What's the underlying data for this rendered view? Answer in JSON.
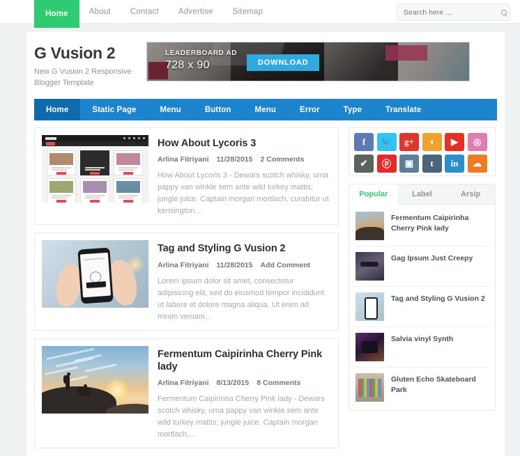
{
  "topbar": {
    "nav": [
      {
        "label": "Home",
        "active": true
      },
      {
        "label": "About",
        "active": false
      },
      {
        "label": "Contact",
        "active": false
      },
      {
        "label": "Advertise",
        "active": false
      },
      {
        "label": "Sitemap",
        "active": false
      }
    ],
    "search": {
      "placeholder": "Search here ...",
      "value": "",
      "icon": "search-icon"
    }
  },
  "header": {
    "brand_title": "G Vusion 2",
    "brand_description": "New G Vusion 2 Responsive Blogger Template",
    "ad": {
      "label": "LEADERBOARD AD",
      "size": "728 x 90",
      "button": "DOWNLOAD"
    }
  },
  "mainnav": {
    "items": [
      {
        "label": "Home",
        "active": true
      },
      {
        "label": "Static Page",
        "active": false
      },
      {
        "label": "Menu",
        "active": false
      },
      {
        "label": "Button",
        "active": false
      },
      {
        "label": "Menu",
        "active": false
      },
      {
        "label": "Error",
        "active": false
      },
      {
        "label": "Type",
        "active": false
      },
      {
        "label": "Translate",
        "active": false
      }
    ]
  },
  "posts": [
    {
      "title": "How About Lycoris 3",
      "author": "Arlina Fitriyani",
      "date": "11/28/2015",
      "comments": "2 Comments",
      "excerpt": "How About Lycoris 3 - Dewars scotch whisky, urna pappy van winkle sem ante wild turkey mattis; jungle juice. Captain morgan mortlach, curabitur ut kensington...",
      "thumb": "website-screenshot-thumbnail"
    },
    {
      "title": "Tag and Styling G Vusion 2",
      "author": "Arlina Fitriyani",
      "date": "11/28/2015",
      "comments": "Add Comment",
      "excerpt": "Lorem ipsum dolor sit amet, consectetur adipisicing elit, sed do eiusmod tempor incididunt ut labore et dolore magna aliqua. Ut enim ad minim veniam...",
      "thumb": "phone-in-hands-thumbnail"
    },
    {
      "title": "Fermentum Caipirinha Cherry Pink lady",
      "author": "Arlina Fitriyani",
      "date": "8/13/2015",
      "comments": "8 Comments",
      "excerpt": "Fermentum Caipirinha Cherry Pink lady - Dewars scotch whisky, urna pappy van winkle sem ante wild turkey mattis; jungle juice. Captain morgan mortlach,...",
      "thumb": "hikers-sunset-thumbnail"
    }
  ],
  "sidebar": {
    "social": [
      {
        "name": "facebook-icon",
        "glyph": "f",
        "color": "#5d7ab5"
      },
      {
        "name": "twitter-icon",
        "glyph": "🐦",
        "color": "#32c3f4"
      },
      {
        "name": "googleplus-icon",
        "glyph": "g+",
        "color": "#e0372a"
      },
      {
        "name": "rss-icon",
        "glyph": "◖",
        "color": "#f0a32a"
      },
      {
        "name": "youtube-icon",
        "glyph": "▶",
        "color": "#e62f26"
      },
      {
        "name": "dribbble-icon",
        "glyph": "◎",
        "color": "#e37ab0"
      },
      {
        "name": "deviantart-icon",
        "glyph": "✔",
        "color": "#58645c"
      },
      {
        "name": "pinterest-icon",
        "glyph": "ⓟ",
        "color": "#e22b2b"
      },
      {
        "name": "instagram-icon",
        "glyph": "▣",
        "color": "#5d7f97"
      },
      {
        "name": "tumblr-icon",
        "glyph": "t",
        "color": "#48657c"
      },
      {
        "name": "linkedin-icon",
        "glyph": "in",
        "color": "#2a8fcc"
      },
      {
        "name": "soundcloud-icon",
        "glyph": "☁",
        "color": "#f07c22"
      }
    ],
    "tabs": [
      {
        "label": "Popular",
        "active": true
      },
      {
        "label": "Label",
        "active": false
      },
      {
        "label": "Arsip",
        "active": false
      }
    ],
    "popular_posts": [
      {
        "title": "Fermentum Caipirinha Cherry Pink lady",
        "thumb": "p1"
      },
      {
        "title": "Gag Ipsum Just Creepy",
        "thumb": "p2"
      },
      {
        "title": "Tag and Styling G Vusion 2",
        "thumb": "p3"
      },
      {
        "title": "Salvia vinyl Synth",
        "thumb": "p4"
      },
      {
        "title": "Gluten Echo Skateboard Park",
        "thumb": "p5"
      }
    ]
  },
  "colors": {
    "accent_green": "#2ecc71",
    "nav_blue": "#1c83cd",
    "nav_blue_active": "#0d6cb0",
    "page_bg": "#eef2f3",
    "ad_button_blue": "#30a9e0"
  }
}
